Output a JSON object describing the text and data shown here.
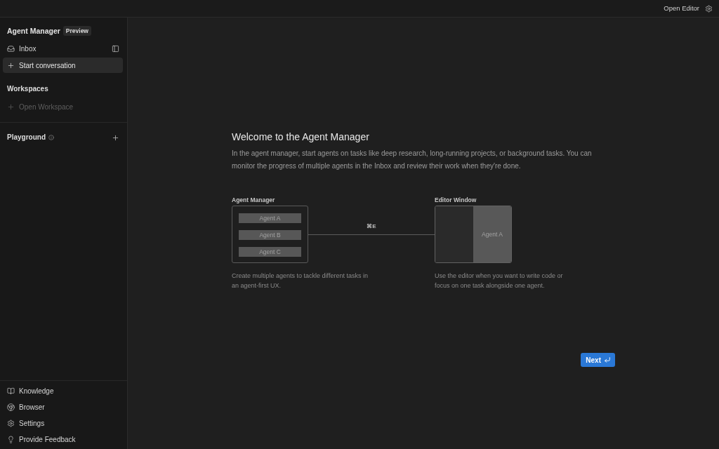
{
  "top_bar": {
    "open_editor": "Open Editor"
  },
  "sidebar": {
    "title": "Agent Manager",
    "badge": "Preview",
    "nav": [
      {
        "label": "Inbox",
        "selected": false
      },
      {
        "label": "Start conversation",
        "selected": true
      }
    ],
    "workspaces": {
      "title": "Workspaces",
      "items": [
        {
          "label": "Open Workspace",
          "disabled": true
        }
      ]
    },
    "playground": {
      "title": "Playground"
    },
    "footer": [
      {
        "label": "Knowledge"
      },
      {
        "label": "Browser"
      },
      {
        "label": "Settings"
      },
      {
        "label": "Provide Feedback"
      }
    ]
  },
  "main": {
    "title": "Welcome to the Agent Manager",
    "description": "In the agent manager, start agents on tasks like deep research, long-running projects, or background tasks. You can monitor the progress of multiple agents in the Inbox and review their work when they're done.",
    "diagram": {
      "manager": {
        "label": "Agent Manager",
        "agents": [
          "Agent A",
          "Agent B",
          "Agent C"
        ],
        "caption": "Create multiple agents to tackle different tasks in an agent-first UX."
      },
      "shortcut": "⌘E",
      "editor": {
        "label": "Editor Window",
        "agent": "Agent A",
        "caption": "Use the editor when you want to write code or focus on one task alongside one agent."
      }
    },
    "next_button": {
      "label": "Next"
    }
  }
}
